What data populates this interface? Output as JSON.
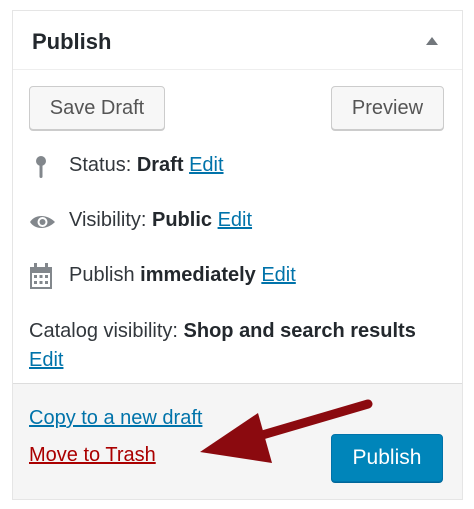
{
  "box": {
    "title": "Publish"
  },
  "buttons": {
    "save_draft": "Save Draft",
    "preview": "Preview",
    "publish": "Publish"
  },
  "status": {
    "label": "Status:",
    "value": "Draft",
    "edit": "Edit"
  },
  "visibility": {
    "label": "Visibility:",
    "value": "Public",
    "edit": "Edit"
  },
  "schedule": {
    "label": "Publish",
    "value": "immediately",
    "edit": "Edit"
  },
  "catalog": {
    "label": "Catalog visibility:",
    "value": "Shop and search results",
    "edit": "Edit"
  },
  "actions": {
    "copy": "Copy to a new draft",
    "trash": "Move to Trash"
  },
  "colors": {
    "link": "#0073aa",
    "trash": "#aa0000",
    "publish_bg": "#0085ba",
    "annotation_arrow": "#8b0a0f"
  },
  "icons": {
    "status": "pin-icon",
    "visibility": "eye-icon",
    "schedule": "calendar-icon"
  }
}
